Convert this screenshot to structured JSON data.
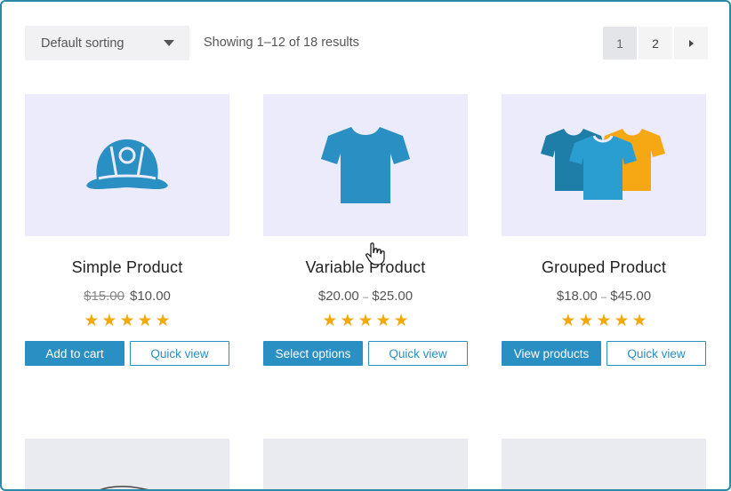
{
  "toolbar": {
    "sort_label": "Default sorting",
    "result_count": "Showing 1–12 of 18 results",
    "pages": [
      "1",
      "2"
    ]
  },
  "products": [
    {
      "title": "Simple Product",
      "price_old": "$15.00",
      "price": "$10.00",
      "rating": 5,
      "primary_button": "Add to cart",
      "secondary_button": "Quick view",
      "icon": "cap-icon"
    },
    {
      "title": "Variable Product",
      "price_low": "$20.00",
      "price_sep": "–",
      "price_high": "$25.00",
      "rating": 5,
      "primary_button": "Select options",
      "secondary_button": "Quick view",
      "icon": "tshirt-icon"
    },
    {
      "title": "Grouped Product",
      "price_low": "$18.00",
      "price_sep": "–",
      "price_high": "$45.00",
      "rating": 5,
      "primary_button": "View products",
      "secondary_button": "Quick view",
      "icon": "tshirts-group-icon"
    }
  ],
  "colors": {
    "accent": "#2a8fc2",
    "star": "#f2a90e",
    "thumb_bg": "#ebebfc",
    "shirt_orange": "#f6a814",
    "frame": "#2a8aa8"
  }
}
